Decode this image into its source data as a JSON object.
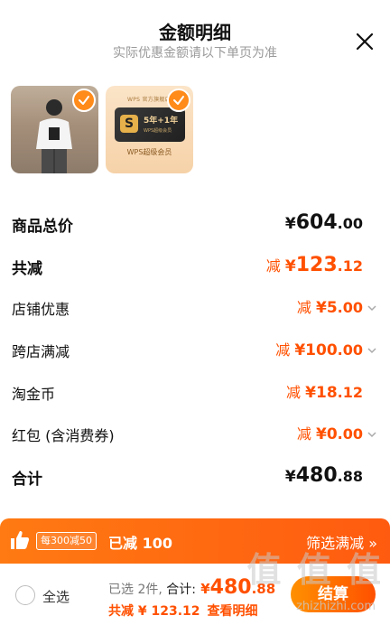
{
  "header": {
    "title": "金额明细",
    "subtitle": "实际优惠金额请以下单页为准"
  },
  "products": [
    {
      "kind": "clothing-photo",
      "checked": true
    },
    {
      "kind": "wps-membership",
      "checked": true,
      "brand": "WPS 官方旗舰店",
      "card_years": "5年+1年",
      "card_sub": "WPS超级会员",
      "member_label": "WPS超级会员"
    }
  ],
  "rows": [
    {
      "label": "商品总价",
      "prefix": "",
      "yen": "¥",
      "int": "604",
      "dec": ".00",
      "color": "black",
      "bold": true,
      "arrow": false
    },
    {
      "label": "共减",
      "prefix": "减 ",
      "yen": "¥",
      "int": "123",
      "dec": ".12",
      "color": "orange",
      "bold": true,
      "arrow": false
    },
    {
      "label": "店铺优惠",
      "prefix": "减 ",
      "yen": "¥",
      "int": "5",
      "dec": ".00",
      "color": "orange",
      "bold": false,
      "arrow": true
    },
    {
      "label": "跨店满减",
      "prefix": "减 ",
      "yen": "¥",
      "int": "100",
      "dec": ".00",
      "color": "orange",
      "bold": false,
      "arrow": true
    },
    {
      "label": "淘金币",
      "prefix": "减 ",
      "yen": "¥",
      "int": "18",
      "dec": ".12",
      "color": "orange",
      "bold": false,
      "arrow": false
    },
    {
      "label": "红包 (含消费券)",
      "prefix": "减 ",
      "yen": "¥",
      "int": "0",
      "dec": ".00",
      "color": "orange",
      "bold": false,
      "arrow": true
    },
    {
      "label": "合计",
      "prefix": "",
      "yen": "¥",
      "int": "480",
      "dec": ".88",
      "color": "black",
      "bold": true,
      "arrow": false
    }
  ],
  "promo_banner": {
    "tag": "每300减50",
    "reduced": "已减 100",
    "filter_label": "筛选满减 »"
  },
  "bottom_bar": {
    "select_all": "全选",
    "selected_count": "已选 2件,",
    "total_label": " 合计:",
    "total_yen": " ¥",
    "total_int": "480",
    "total_dec": ".88",
    "reduce_text": "共减 ¥ 123.12",
    "view_detail": "查看明细",
    "checkout": "结算"
  },
  "watermark": {
    "text": "值 值 值",
    "url": "zhizhizhi.com"
  },
  "colors": {
    "accent": "#ff5000",
    "check": "#ff8b1a",
    "banner_start": "#ff7a12",
    "banner_end": "#ff5b10"
  }
}
